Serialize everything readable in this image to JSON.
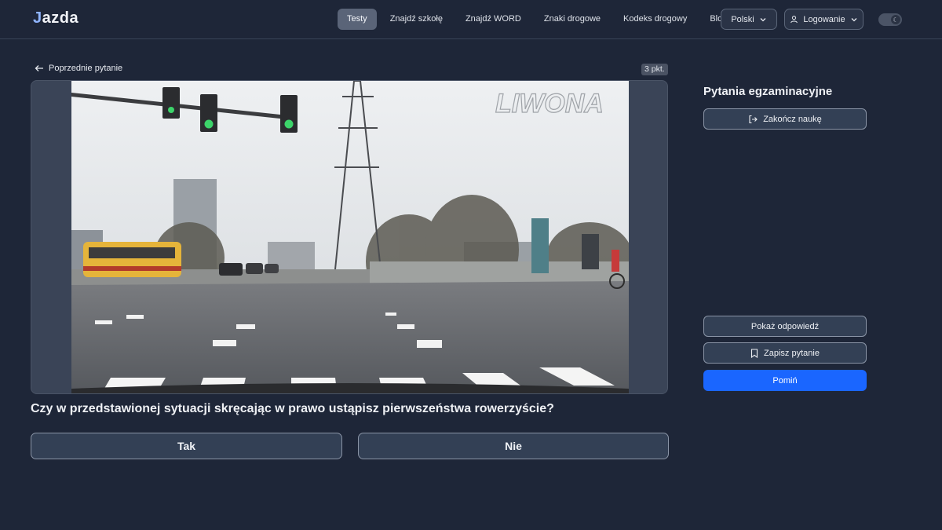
{
  "header": {
    "logo_j": "J",
    "logo_rest": "azda",
    "nav": [
      {
        "label": "Testy",
        "active": true
      },
      {
        "label": "Znajdź szkołę"
      },
      {
        "label": "Znajdź WORD"
      },
      {
        "label": "Znaki drogowe"
      },
      {
        "label": "Kodeks drogowy"
      },
      {
        "label": "Blog"
      }
    ],
    "language": "Polski",
    "login": "Logowanie"
  },
  "question_panel": {
    "back_label": "Poprzednie pytanie",
    "points": "3 pkt.",
    "watermark": "LIWONA",
    "question": "Czy w przedstawionej sytuacji skręcając w prawo ustąpisz pierwszeństwa rowerzyście?",
    "answers": [
      "Tak",
      "Nie"
    ]
  },
  "sidebar": {
    "title": "Pytania egzaminacyjne",
    "finish_label": "Zakończ naukę",
    "show_answer_label": "Pokaż odpowiedź",
    "save_label": "Zapisz pytanie",
    "skip_label": "Pomiń"
  },
  "colors": {
    "background": "#1e2638",
    "primary": "#1a66ff",
    "button_bg": "#334055"
  }
}
